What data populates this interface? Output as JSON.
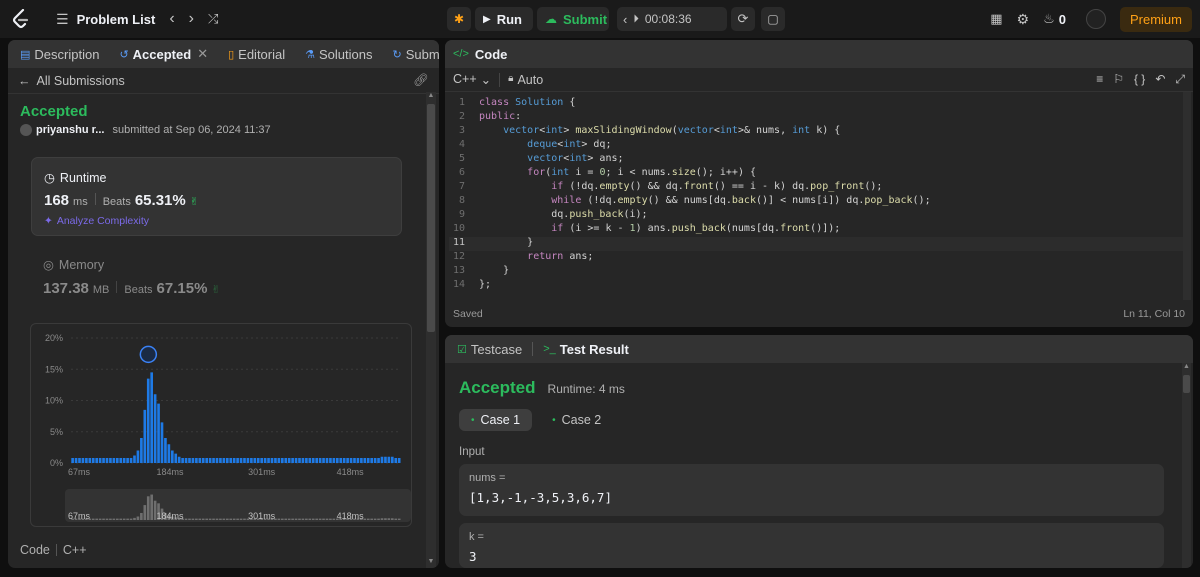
{
  "topbar": {
    "problem_list": "Problem List",
    "run": "Run",
    "submit": "Submit",
    "timer": "00:08:36",
    "streak_count": "0",
    "premium": "Premium"
  },
  "left_tabs": [
    "Description",
    "Accepted",
    "Editorial",
    "Solutions",
    "Submissions"
  ],
  "submission": {
    "back_label": "All Submissions",
    "status": "Accepted",
    "user": "priyanshu r...",
    "submitted_at": "submitted at Sep 06, 2024 11:37",
    "editorial_btn": "Editorial",
    "solution_btn": "Solution",
    "runtime_label": "Runtime",
    "runtime_value": "168",
    "runtime_unit": "ms",
    "runtime_beats_label": "Beats",
    "runtime_beats": "65.31%",
    "analyze": "Analyze Complexity",
    "memory_label": "Memory",
    "memory_value": "137.38",
    "memory_unit": "MB",
    "memory_beats_label": "Beats",
    "memory_beats": "67.15%",
    "code_label": "Code",
    "code_lang": "C++"
  },
  "chart_data": {
    "type": "bar",
    "y_ticks": [
      "20%",
      "15%",
      "10%",
      "5%",
      "0%"
    ],
    "x_ticks": [
      "67ms",
      "184ms",
      "301ms",
      "418ms"
    ],
    "ylim": [
      0,
      20
    ],
    "values": [
      0.8,
      0.8,
      0.8,
      0.8,
      0.8,
      0.8,
      0.8,
      0.8,
      0.8,
      0.8,
      0.8,
      0.8,
      0.8,
      0.8,
      0.8,
      0.8,
      0.8,
      0.8,
      1.2,
      2.0,
      4.0,
      8.5,
      13.5,
      14.5,
      11.0,
      9.5,
      6.5,
      4.0,
      3.0,
      2.0,
      1.5,
      1.0,
      0.8,
      0.8,
      0.8,
      0.8,
      0.8,
      0.8,
      0.8,
      0.8,
      0.8,
      0.8,
      0.8,
      0.8,
      0.8,
      0.8,
      0.8,
      0.8,
      0.8,
      0.8,
      0.8,
      0.8,
      0.8,
      0.8,
      0.8,
      0.8,
      0.8,
      0.8,
      0.8,
      0.8,
      0.8,
      0.8,
      0.8,
      0.8,
      0.8,
      0.8,
      0.8,
      0.8,
      0.8,
      0.8,
      0.8,
      0.8,
      0.8,
      0.8,
      0.8,
      0.8,
      0.8,
      0.8,
      0.8,
      0.8,
      0.8,
      0.8,
      0.8,
      0.8,
      0.8,
      0.8,
      0.8,
      0.8,
      0.8,
      0.8,
      1.0,
      1.0,
      1.0,
      1.0,
      0.8,
      0.8
    ],
    "highlight_index": 23
  },
  "code_panel": {
    "title": "Code",
    "lang": "C++",
    "mode": "Auto",
    "status": "Saved",
    "cursor": "Ln 11, Col 10"
  },
  "code_lines": [
    {
      "n": "1",
      "html": "<span class='kw'>class</span> <span class='ty'>Solution</span> <span class='tx'>{</span>"
    },
    {
      "n": "2",
      "html": "<span class='kw'>public</span><span class='tx'>:</span>"
    },
    {
      "n": "3",
      "html": "    <span class='ty'>vector</span><span class='tx'>&lt;</span><span class='ty'>int</span><span class='tx'>&gt; </span><span class='fn'>maxSlidingWindow</span><span class='tx'>(</span><span class='ty'>vector</span><span class='tx'>&lt;</span><span class='ty'>int</span><span class='tx'>&gt;&amp; nums, </span><span class='ty'>int</span><span class='tx'> k) {</span>"
    },
    {
      "n": "4",
      "html": "        <span class='ty'>deque</span><span class='tx'>&lt;</span><span class='ty'>int</span><span class='tx'>&gt; dq;</span>"
    },
    {
      "n": "5",
      "html": "        <span class='ty'>vector</span><span class='tx'>&lt;</span><span class='ty'>int</span><span class='tx'>&gt; ans;</span>"
    },
    {
      "n": "6",
      "html": "        <span class='kw'>for</span><span class='tx'>(</span><span class='ty'>int</span><span class='tx'> i = </span><span class='nm'>0</span><span class='tx'>; i &lt; nums.</span><span class='fn'>size</span><span class='tx'>(); i++) {</span>"
    },
    {
      "n": "7",
      "html": "            <span class='kw'>if</span><span class='tx'> (!dq.</span><span class='fn'>empty</span><span class='tx'>() &amp;&amp; dq.</span><span class='fn'>front</span><span class='tx'>() == i - k) dq.</span><span class='fn'>pop_front</span><span class='tx'>();</span>"
    },
    {
      "n": "8",
      "html": "            <span class='kw'>while</span><span class='tx'> (!dq.</span><span class='fn'>empty</span><span class='tx'>() &amp;&amp; nums[dq.</span><span class='fn'>back</span><span class='tx'>()] &lt; nums[i]) dq.</span><span class='fn'>pop_back</span><span class='tx'>();</span>"
    },
    {
      "n": "9",
      "html": "            <span class='tx'>dq.</span><span class='fn'>push_back</span><span class='tx'>(i);</span>"
    },
    {
      "n": "10",
      "html": "            <span class='kw'>if</span><span class='tx'> (i &gt;= k - </span><span class='nm'>1</span><span class='tx'>) ans.</span><span class='fn'>push_back</span><span class='tx'>(nums[dq.</span><span class='fn'>front</span><span class='tx'>()]);</span>"
    },
    {
      "n": "11",
      "html": "        <span class='tx'>}</span>"
    },
    {
      "n": "12",
      "html": "        <span class='kw'>return</span><span class='tx'> ans;</span>"
    },
    {
      "n": "13",
      "html": "    <span class='tx'>}</span>"
    },
    {
      "n": "14",
      "html": "<span class='tx'>};</span>"
    }
  ],
  "test_panel": {
    "tab_testcase": "Testcase",
    "tab_result": "Test Result",
    "status": "Accepted",
    "runtime": "Runtime: 4 ms",
    "case1": "Case 1",
    "case2": "Case 2",
    "input_label": "Input",
    "var1_name": "nums =",
    "var1_value": "[1,3,-1,-3,5,3,6,7]",
    "var2_name": "k =",
    "var2_value": "3"
  },
  "colors": {
    "accent_green": "#2cbb5d",
    "bar_blue": "#1e7ae6",
    "premium": "#ffa116"
  }
}
